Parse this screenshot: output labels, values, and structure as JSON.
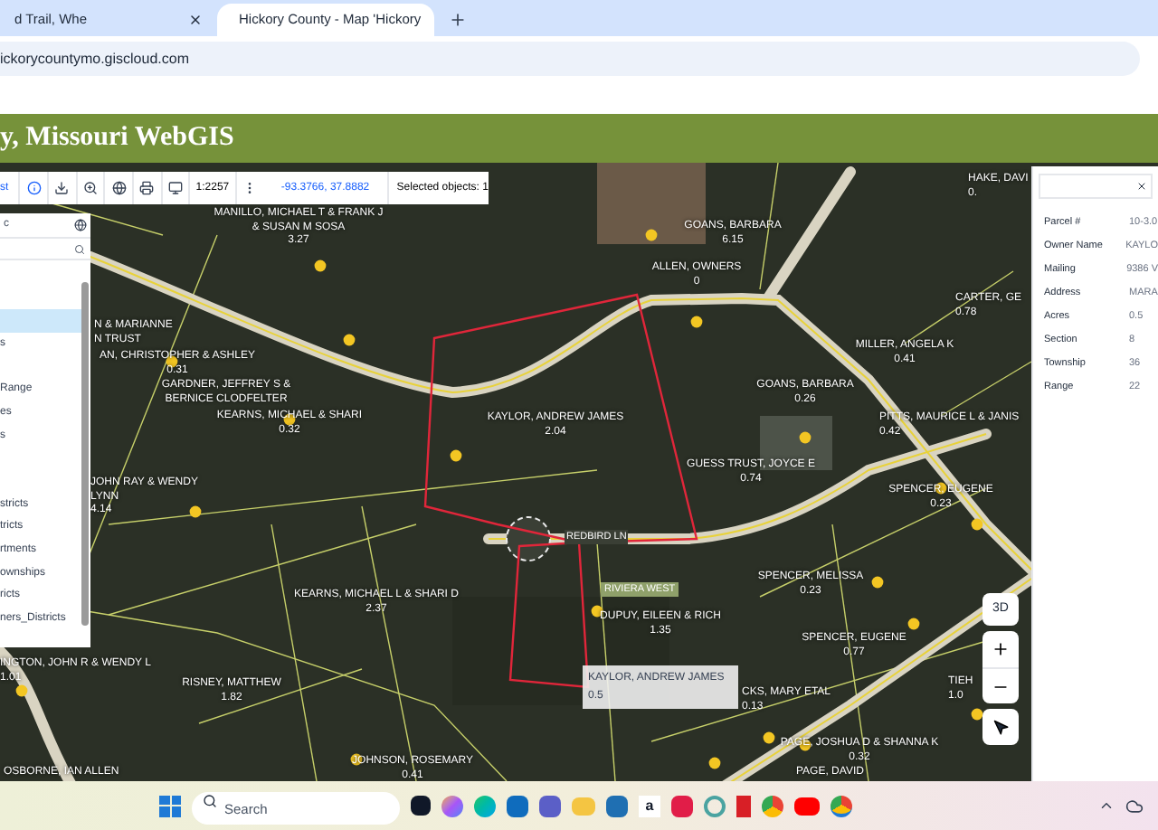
{
  "browser": {
    "tabs": [
      {
        "title": "d Trail, Whe",
        "selected": false
      },
      {
        "title": "Hickory County - Map 'Hickory",
        "selected": true
      }
    ],
    "address": "ickorycountymo.giscloud.com"
  },
  "header": {
    "title": "y, Missouri WebGIS"
  },
  "toolbar": {
    "first": "st",
    "scale": "1:2257",
    "coordinates": "-93.3766, 37.8882",
    "selection": "Selected objects: 1"
  },
  "layers": {
    "title": "c",
    "items": [
      {
        "selected": false
      },
      {
        "selected": false
      },
      {
        "selected": true
      },
      {
        "label": "s",
        "selected": false
      },
      {
        "selected": false
      },
      {
        "label": "Range",
        "selected": false
      },
      {
        "label": "es",
        "selected": false
      },
      {
        "label": "s",
        "selected": false
      },
      {
        "selected": false
      },
      {
        "selected": false
      },
      {
        "label": "stricts",
        "selected": false
      },
      {
        "label": "tricts",
        "selected": false
      },
      {
        "label": "rtments",
        "selected": false
      },
      {
        "label": "ownships",
        "selected": false
      },
      {
        "label": "ricts",
        "selected": false
      },
      {
        "label": "ners_Districts",
        "selected": false
      }
    ]
  },
  "map": {
    "labels": [
      {
        "lines": [
          "MANILLO, MICHAEL T & FRANK J",
          "& SUSAN M SOSA",
          "3.27"
        ]
      },
      {
        "lines": [
          "HAKE, DAVI",
          "0."
        ]
      },
      {
        "lines": [
          "GOANS, BARBARA",
          "6.15"
        ]
      },
      {
        "lines": [
          "ALLEN, OWNERS",
          "0"
        ]
      },
      {
        "lines": [
          "CARTER, GE",
          "0.78"
        ]
      },
      {
        "lines": [
          "N & MARIANNE",
          "N TRUST"
        ]
      },
      {
        "lines": [
          "AN, CHRISTOPHER & ASHLEY",
          "0.31"
        ]
      },
      {
        "lines": [
          "GARDNER, JEFFREY S &",
          "BERNICE CLODFELTER"
        ]
      },
      {
        "lines": [
          "KEARNS, MICHAEL & SHARI",
          "0.32"
        ]
      },
      {
        "lines": [
          "MILLER, ANGELA K",
          "0.41"
        ]
      },
      {
        "lines": [
          "GOANS, BARBARA",
          "0.26"
        ]
      },
      {
        "lines": [
          "KAYLOR, ANDREW JAMES",
          "2.04"
        ]
      },
      {
        "lines": [
          "PITTS, MAURICE L & JANIS",
          "0.42"
        ]
      },
      {
        "lines": [
          "GUESS TRUST, JOYCE E",
          "0.74"
        ]
      },
      {
        "lines": [
          "JOHN RAY & WENDY",
          "LYNN",
          "4.14"
        ]
      },
      {
        "lines": [
          "SPENCER, EUGENE",
          "0.23"
        ]
      },
      {
        "lines": [
          "KEARNS, MICHAEL L & SHARI D",
          "2.37"
        ]
      },
      {
        "lines": [
          "SPENCER, MELISSA",
          "0.23"
        ]
      },
      {
        "lines": [
          "DUPUY, EILEEN & RICH",
          "1.35"
        ]
      },
      {
        "lines": [
          "SPENCER, EUGENE",
          "0.77"
        ]
      },
      {
        "lines": [
          "INGTON, JOHN R & WENDY L",
          "1.01"
        ]
      },
      {
        "lines": [
          "RISNEY, MATTHEW",
          "1.82"
        ]
      },
      {
        "lines": [
          "CKS, MARY ETAL",
          "0.13"
        ]
      },
      {
        "lines": [
          "TIEH",
          "1.0"
        ]
      },
      {
        "lines": [
          "PAGE, JOSHUA D & SHANNA K",
          "0.32"
        ]
      },
      {
        "lines": [
          "OSBORNE, IAN ALLEN"
        ]
      },
      {
        "lines": [
          "JOHNSON, ROSEMARY",
          "0.41"
        ]
      },
      {
        "lines": [
          "PAGE, DAVID"
        ]
      }
    ],
    "road_label": "REDBIRD LN",
    "subdivision_label": "RIVIERA WEST",
    "tooltip": {
      "owner": "KAYLOR, ANDREW JAMES",
      "acres": "0.5"
    },
    "controls": {
      "view_3d": "3D"
    }
  },
  "info": {
    "rows": [
      {
        "label": "Parcel #",
        "value": "10-3.0"
      },
      {
        "label": "Owner Name",
        "value": "KAYLO"
      },
      {
        "label": "Mailing",
        "value": "9386 V"
      },
      {
        "label": "Address",
        "value": "MARA"
      },
      {
        "label": "Acres",
        "value": "0.5"
      },
      {
        "label": "Section",
        "value": "8"
      },
      {
        "label": "Township",
        "value": "36"
      },
      {
        "label": "Range",
        "value": "22"
      }
    ]
  },
  "taskbar": {
    "search": {
      "placeholder": "Search"
    },
    "app_letter": "a"
  }
}
